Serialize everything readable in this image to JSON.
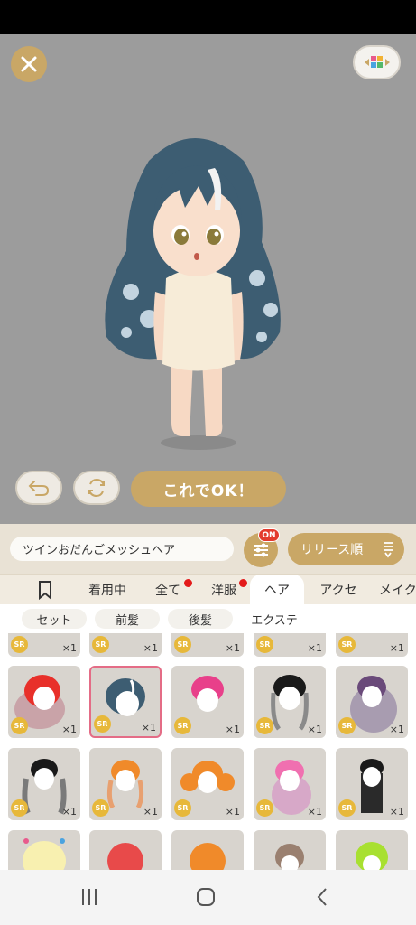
{
  "preview": {
    "ok_label": "これでOK！"
  },
  "panel": {
    "item_name": "ツインおだんごメッシュヘア",
    "filter_badge": "ON",
    "sort_label": "リリース順"
  },
  "category_tabs": [
    "着用中",
    "全て",
    "洋服",
    "ヘア",
    "アクセ",
    "メイク"
  ],
  "sub_tabs": [
    "セット",
    "前髪",
    "後髪",
    "エクステ"
  ],
  "items": {
    "rarity": "SR",
    "quantity": "×1"
  },
  "colors": {
    "accent_gold": "#c9a766",
    "badge_red": "#e33b2e",
    "selected_border": "#e46c86",
    "sr_badge": "#e7b83a"
  },
  "icons": [
    "close-icon",
    "color-palette-icon",
    "undo-icon",
    "shuffle-icon",
    "filter-sliders-icon",
    "sort-icon",
    "bookmark-icon",
    "recents-icon",
    "home-icon",
    "back-icon"
  ]
}
